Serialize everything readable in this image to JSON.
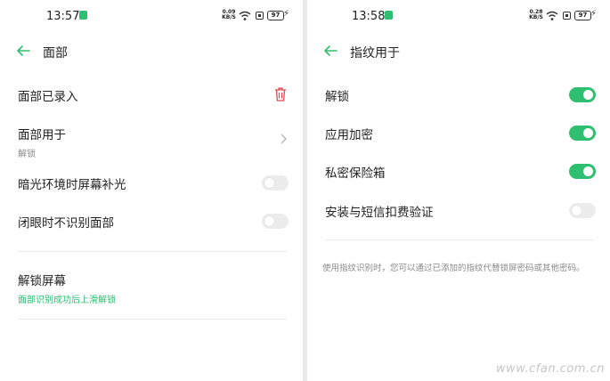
{
  "left": {
    "status": {
      "time": "13:57",
      "speed_value": "0.09",
      "speed_unit": "KB/S",
      "battery": "97"
    },
    "header": {
      "title": "面部"
    },
    "rows": [
      {
        "label": "面部已录入"
      },
      {
        "label": "面部用于",
        "sub": "解锁"
      },
      {
        "label": "暗光环境时屏幕补光",
        "toggle": "off"
      },
      {
        "label": "闭眼时不识别面部",
        "toggle": "off"
      },
      {
        "label": "解锁屏幕",
        "sub": "面部识别成功后上滑解锁"
      }
    ]
  },
  "right": {
    "status": {
      "time": "13:58",
      "speed_value": "0.28",
      "speed_unit": "KB/S",
      "battery": "97"
    },
    "header": {
      "title": "指纹用于"
    },
    "rows": [
      {
        "label": "解锁",
        "toggle": "on"
      },
      {
        "label": "应用加密",
        "toggle": "on"
      },
      {
        "label": "私密保险箱",
        "toggle": "on"
      },
      {
        "label": "安装与短信扣费验证",
        "toggle": "off"
      }
    ],
    "note": "使用指纹识别时，您可以通过已添加的指纹代替锁屏密码或其他密码。"
  },
  "watermark": "www.cfan.com.cn",
  "colors": {
    "accent": "#2fbf71",
    "delete": "#e5484d",
    "toggle_off": "#ececec"
  }
}
